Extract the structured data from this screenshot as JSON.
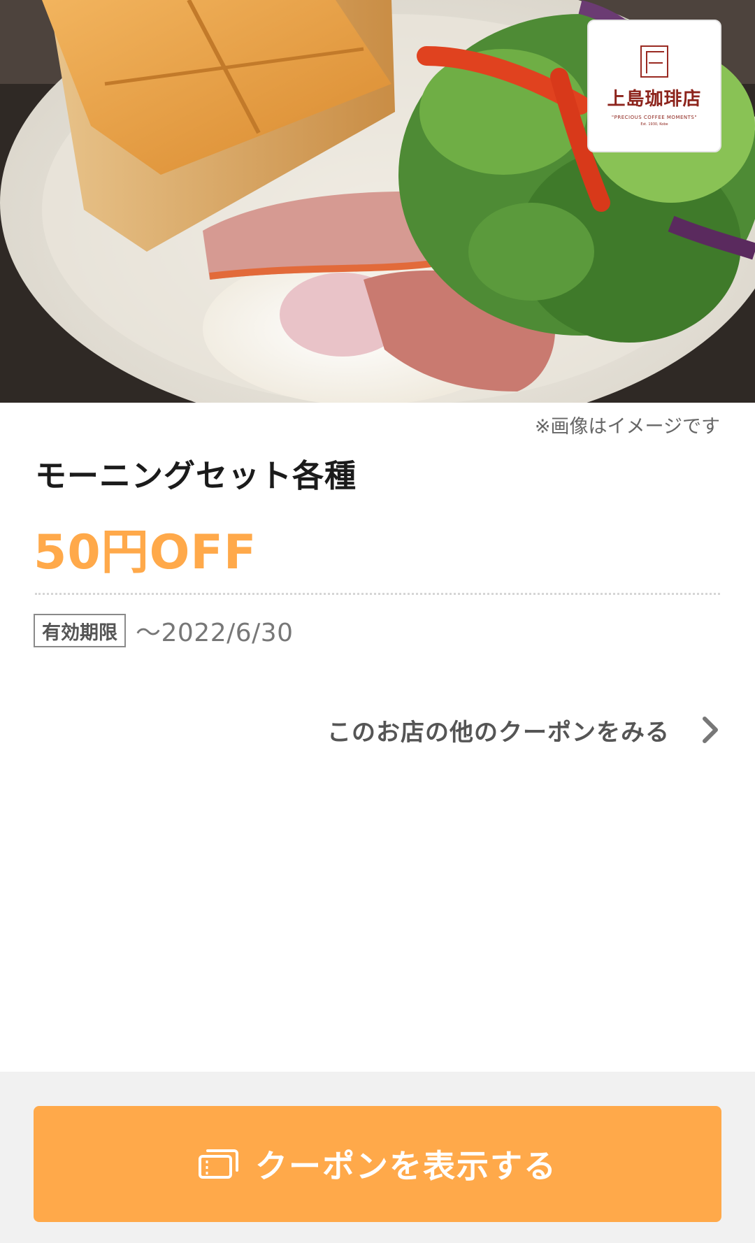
{
  "hero": {
    "image_description": "toast-bacon-egg-salad-photo"
  },
  "brand": {
    "name": "上島珈琲店",
    "tagline": "\"PRECIOUS COFFEE MOMENTS\"",
    "established": "Est. 1930, Kobe"
  },
  "coupon": {
    "image_note": "※画像はイメージです",
    "title": "モーニングセット各種",
    "discount": "50円OFF",
    "validity_label": "有効期限",
    "validity_value": "〜2022/6/30",
    "other_coupons_label": "このお店の他のクーポンをみる"
  },
  "footer": {
    "show_button_label": "クーポンを表示する"
  },
  "colors": {
    "accent": "#ffa94a",
    "brand": "#8d241c",
    "footer_bg": "#f1f1f1"
  },
  "icons": {
    "chevron": "chevron-right-icon",
    "coupon": "coupon-icon"
  }
}
